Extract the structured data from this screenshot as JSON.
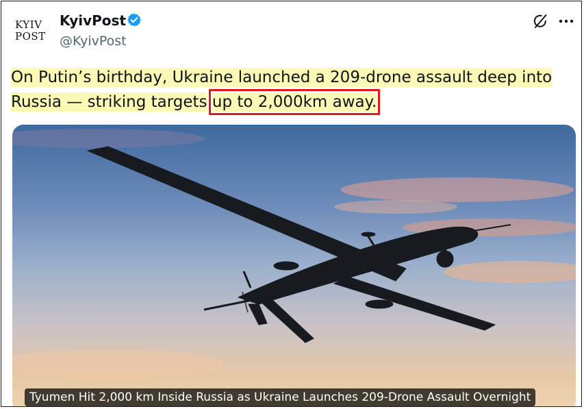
{
  "post": {
    "logo_line1": "KYIV",
    "logo_line2": "POST",
    "author_name": "KyivPost",
    "handle": "@KyivPost",
    "text_part1": "On Putin’s birthday, Ukraine launched a 209-drone assault deep into Russia — striking targets",
    "text_part2": "up to 2,000km away."
  },
  "media": {
    "caption": "Tyumen Hit 2,000 km Inside Russia as Ukraine Launches 209-Drone Assault Overnight"
  },
  "icons": [
    "verified-badge-icon",
    "grok-icon",
    "more-options-icon"
  ],
  "colors": {
    "verified": "#1d9bf0",
    "highlight": "#fcf8b6",
    "annotation_box": "#e01a1a",
    "handle_gray": "#536471"
  }
}
